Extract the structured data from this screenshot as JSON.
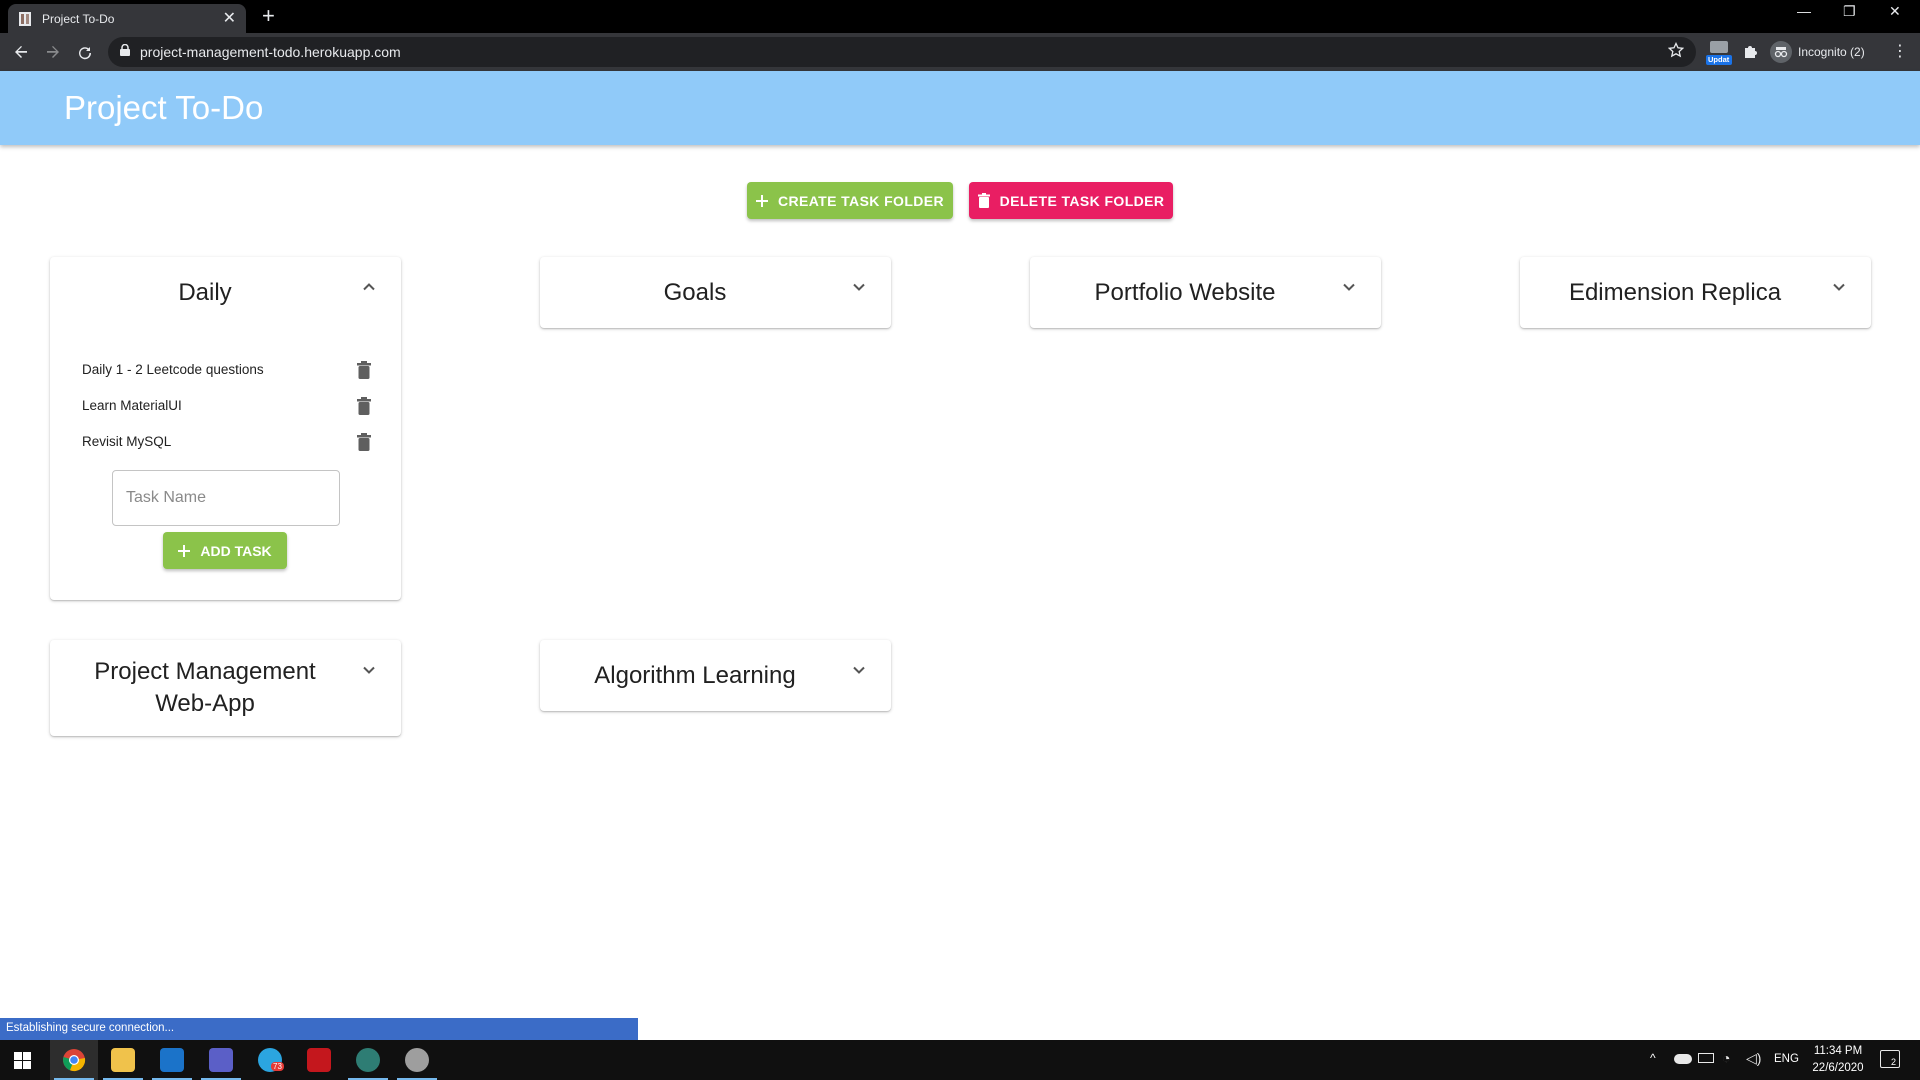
{
  "browser": {
    "tab_title": "Project To-Do",
    "url": "project-management-todo.herokuapp.com",
    "profile_label": "Incognito (2)",
    "extension_badge": "Updat",
    "status_text": "Establishing secure connection..."
  },
  "app": {
    "title": "Project To-Do",
    "create_folder_label": "CREATE TASK FOLDER",
    "delete_folder_label": "DELETE TASK FOLDER"
  },
  "folders": [
    {
      "name": "Daily",
      "expanded": true,
      "tasks": [
        "Daily 1 - 2 Leetcode questions",
        "Learn MaterialUI",
        "Revisit MySQL"
      ],
      "input_placeholder": "Task Name",
      "add_label": "ADD TASK"
    },
    {
      "name": "Goals",
      "expanded": false
    },
    {
      "name": "Portfolio Website",
      "expanded": false
    },
    {
      "name": "Edimension Replica",
      "expanded": false
    },
    {
      "name": "Project Management Web-App",
      "expanded": false
    },
    {
      "name": "Algorithm Learning",
      "expanded": false
    }
  ],
  "taskbar": {
    "language": "ENG",
    "time": "11:34 PM",
    "date": "22/6/2020",
    "notification_count": "2",
    "telegram_badge": "73"
  },
  "colors": {
    "app_bar": "#90caf9",
    "create_button": "#8bc34a",
    "delete_button": "#e91e63",
    "add_button": "#8bc34a"
  }
}
